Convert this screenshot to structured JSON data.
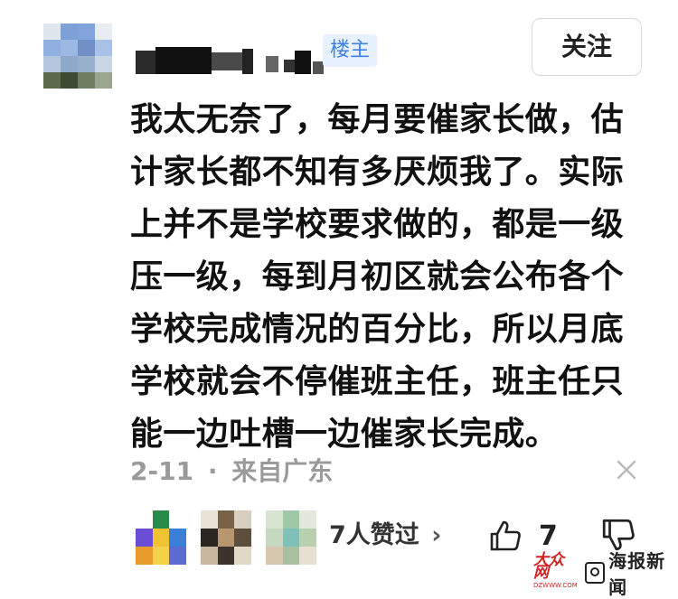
{
  "author": {
    "badge": "楼主",
    "follow_label": "关注"
  },
  "post": {
    "lines": [
      "我太无奈了，每月要催家长做，估",
      "计家长都不知有多厌烦我了。实际",
      "上并不是学校要求做的，都是一级",
      "压一级，每到月初区就会公布各个",
      "学校完成情况的百分比，所以月底",
      "学校就会不停催班主任，班主任只",
      "能一边吐槽一边催家长完成。"
    ],
    "date": "2-11",
    "separator": "·",
    "location": "来自广东"
  },
  "engagement": {
    "likers_text": "7人赞过",
    "likers_chevron": "›",
    "like_count": "7"
  },
  "icons": {
    "dismiss": "close-icon",
    "like": "thumbs-up-icon",
    "dislike": "thumbs-down-icon",
    "chevron": "chevron-right-icon"
  },
  "watermark": {
    "logo_text": "大众网",
    "logo_sub": "DZWWW.COM",
    "brand_text": "海报新闻"
  },
  "colors": {
    "badge_text": "#3f7fe8",
    "badge_bg": "#e8f1ff",
    "meta_text": "#9a9a9a",
    "watermark_red": "#d02323"
  }
}
